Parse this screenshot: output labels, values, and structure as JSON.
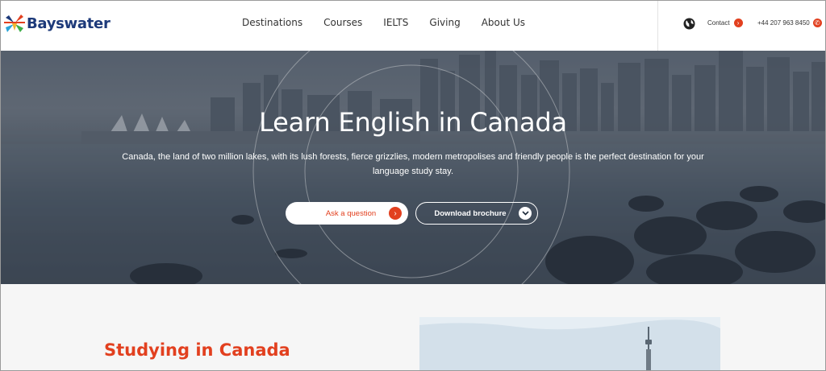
{
  "brand": {
    "name": "Bayswater"
  },
  "nav": {
    "items": [
      {
        "label": "Destinations"
      },
      {
        "label": "Courses"
      },
      {
        "label": "IELTS"
      },
      {
        "label": "Giving"
      },
      {
        "label": "About Us"
      }
    ]
  },
  "utility": {
    "contact_label": "Contact",
    "phone": "+44 207 963 8450",
    "globe_icon": "globe-icon",
    "accent_color": "#e2401f"
  },
  "hero": {
    "title": "Learn English in Canada",
    "subtitle": "Canada, the land of two million lakes, with its lush forests, fierce grizzlies, modern metropolises and friendly people is the perfect destination for your language study stay.",
    "ask_button": "Ask a question",
    "download_button": "Download brochure"
  },
  "section": {
    "title": "Studying in Canada"
  }
}
